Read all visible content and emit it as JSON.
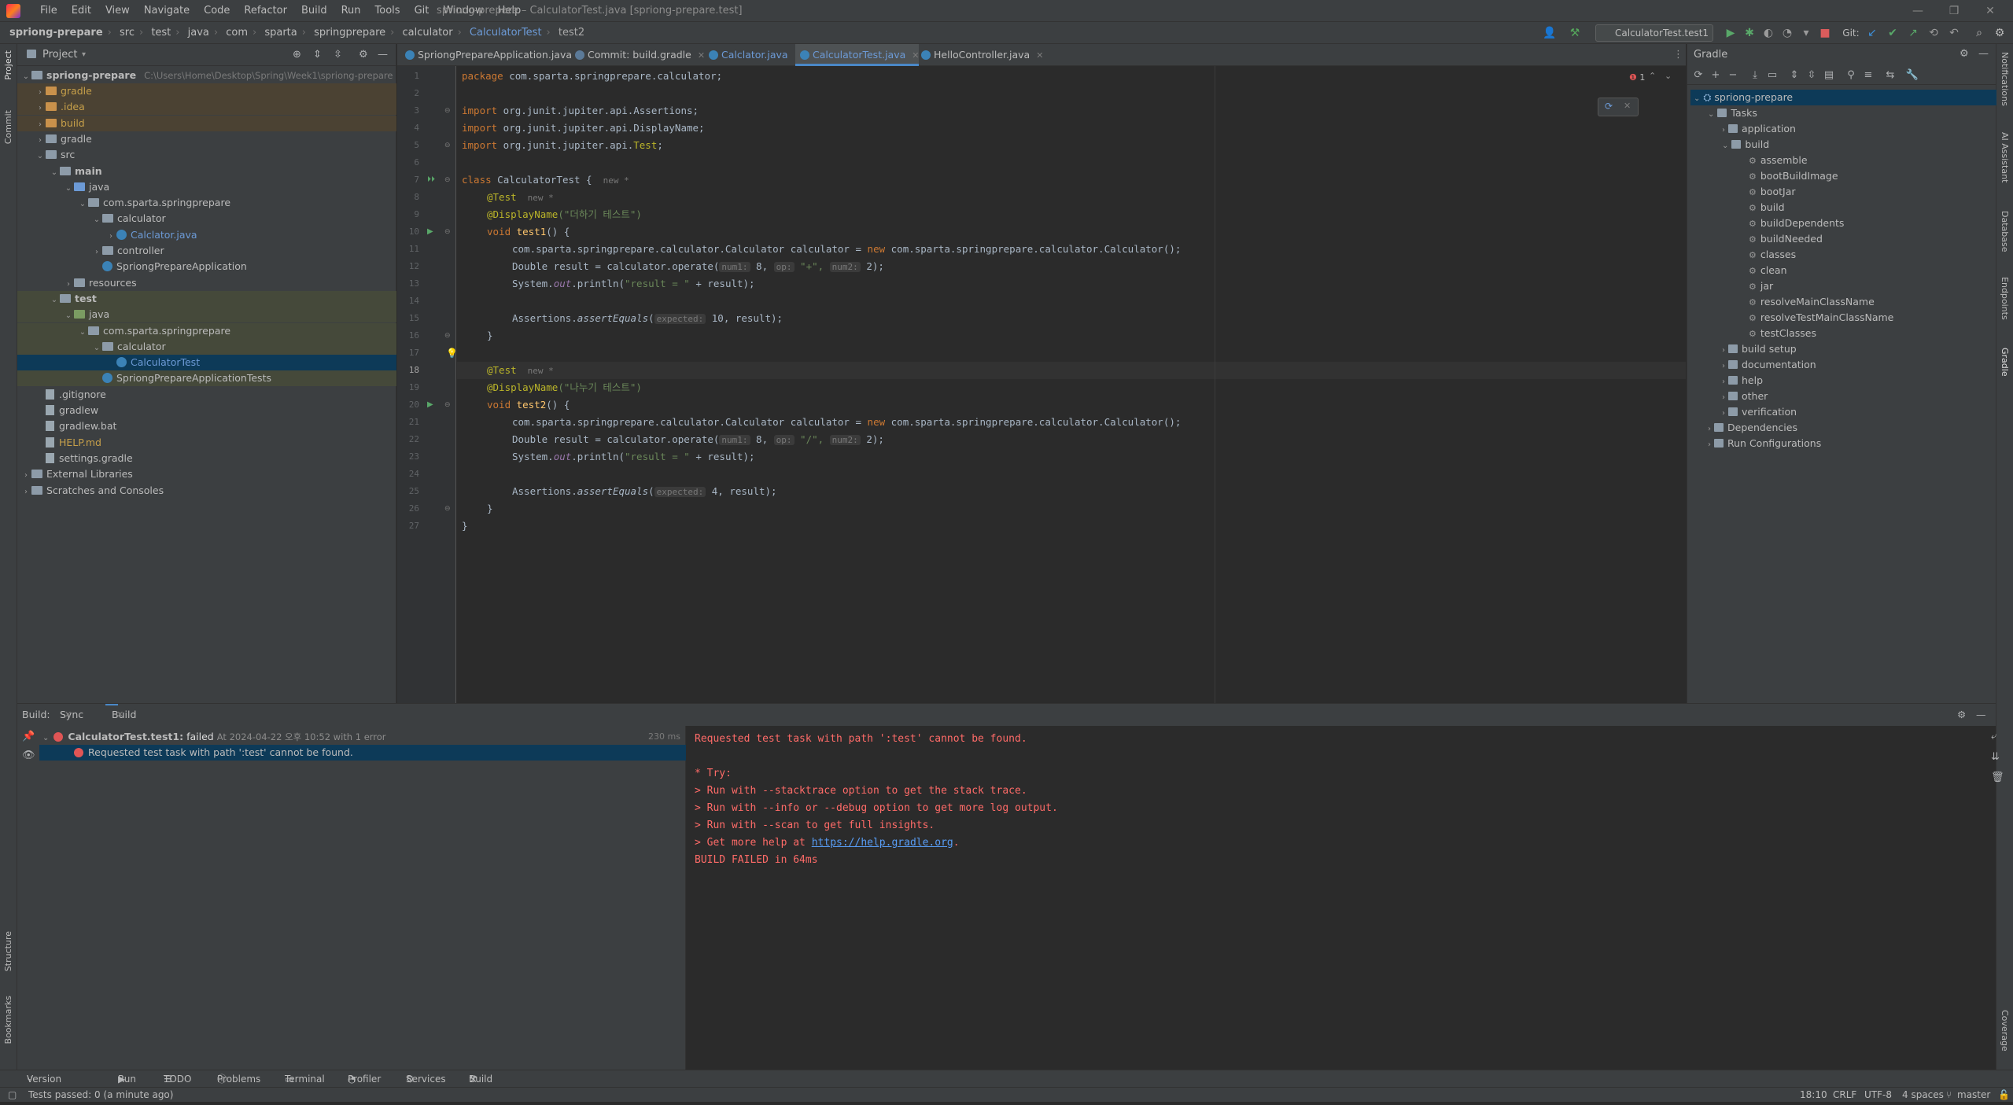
{
  "window": {
    "title": "spriong-prepare – CalculatorTest.java [spriong-prepare.test]",
    "menus": [
      "File",
      "Edit",
      "View",
      "Navigate",
      "Code",
      "Refactor",
      "Build",
      "Run",
      "Tools",
      "Git",
      "Window",
      "Help"
    ]
  },
  "breadcrumb": [
    "spriong-prepare",
    "src",
    "test",
    "java",
    "com",
    "sparta",
    "springprepare",
    "calculator",
    "CalculatorTest",
    "test2"
  ],
  "toolbar": {
    "run_config": "CalculatorTest.test1",
    "git_label": "Git:"
  },
  "project_panel": {
    "title": "Project",
    "root_label": "spriong-prepare",
    "root_path": "C:\\Users\\Home\\Desktop\\Spring\\Week1\\spriong-prepare",
    "items": [
      {
        "label": "gradle",
        "depth": 1,
        "type": "folder-orange",
        "arrow": "›"
      },
      {
        "label": ".idea",
        "depth": 1,
        "type": "folder-orange",
        "arrow": "›"
      },
      {
        "label": "build",
        "depth": 1,
        "type": "folder-orange",
        "arrow": "›"
      },
      {
        "label": "gradle",
        "depth": 1,
        "type": "folder",
        "arrow": "›"
      },
      {
        "label": "src",
        "depth": 1,
        "type": "folder",
        "arrow": "⌄"
      },
      {
        "label": "main",
        "depth": 2,
        "type": "folder",
        "arrow": "⌄"
      },
      {
        "label": "java",
        "depth": 3,
        "type": "folder-blue",
        "arrow": "⌄"
      },
      {
        "label": "com.sparta.springprepare",
        "depth": 4,
        "type": "folder",
        "arrow": "⌄"
      },
      {
        "label": "calculator",
        "depth": 5,
        "type": "folder",
        "arrow": "⌄"
      },
      {
        "label": "Calclator.java",
        "depth": 6,
        "type": "class",
        "arrow": "›"
      },
      {
        "label": "controller",
        "depth": 5,
        "type": "folder",
        "arrow": "›"
      },
      {
        "label": "SpriongPrepareApplication",
        "depth": 5,
        "type": "class",
        "arrow": ""
      },
      {
        "label": "resources",
        "depth": 3,
        "type": "folder",
        "arrow": "›"
      },
      {
        "label": "test",
        "depth": 2,
        "type": "folder",
        "arrow": "⌄"
      },
      {
        "label": "java",
        "depth": 3,
        "type": "folder-green",
        "arrow": "⌄"
      },
      {
        "label": "com.sparta.springprepare",
        "depth": 4,
        "type": "folder",
        "arrow": "⌄"
      },
      {
        "label": "calculator",
        "depth": 5,
        "type": "folder",
        "arrow": "⌄"
      },
      {
        "label": "CalculatorTest",
        "depth": 6,
        "type": "class",
        "arrow": ""
      },
      {
        "label": "SpriongPrepareApplicationTests",
        "depth": 5,
        "type": "class",
        "arrow": ""
      },
      {
        "label": ".gitignore",
        "depth": 1,
        "type": "file",
        "arrow": ""
      },
      {
        "label": "gradlew",
        "depth": 1,
        "type": "file",
        "arrow": ""
      },
      {
        "label": "gradlew.bat",
        "depth": 1,
        "type": "file",
        "arrow": ""
      },
      {
        "label": "HELP.md",
        "depth": 1,
        "type": "file",
        "arrow": ""
      },
      {
        "label": "settings.gradle",
        "depth": 1,
        "type": "file",
        "arrow": ""
      },
      {
        "label": "External Libraries",
        "depth": 0,
        "type": "folder",
        "arrow": "›"
      },
      {
        "label": "Scratches and Consoles",
        "depth": 0,
        "type": "folder",
        "arrow": "›"
      }
    ]
  },
  "editor_tabs": [
    {
      "label": "SpriongPrepareApplication.java"
    },
    {
      "label": "Commit: build.gradle"
    },
    {
      "label": "Calclator.java"
    },
    {
      "label": "CalculatorTest.java"
    },
    {
      "label": "HelloController.java"
    }
  ],
  "editor": {
    "error_count": "1",
    "new_badge": "new *",
    "lines": [
      "1",
      "2",
      "3",
      "4",
      "5",
      "6",
      "7",
      "8",
      "9",
      "10",
      "11",
      "12",
      "13",
      "14",
      "15",
      "16",
      "17",
      "18",
      "19",
      "20",
      "21",
      "22",
      "23",
      "24",
      "25",
      "26",
      "27"
    ],
    "code": {
      "package": "package",
      "package_name": " com.sparta.springprepare.calculator;",
      "import": "import",
      "imp1": " org.junit.jupiter.api.Assertions;",
      "imp2": " org.junit.jupiter.api.DisplayName;",
      "imp3a": " org.junit.jupiter.api.",
      "imp3b": "Test",
      "imp3c": ";",
      "class": "class",
      "class_name": " CalculatorTest {",
      "test_ann": "@Test",
      "display_ann": "@DisplayName",
      "disp1": "(\"더하기 테스트\")",
      "disp2": "(\"나누기 테스트\")",
      "void": "void",
      "test1": " test1",
      "test2": " test2",
      "sig_end": "() {",
      "calc_decl": "com.sparta.springprepare.calculator.Calculator calculator = ",
      "new": "new",
      "calc_new": " com.sparta.springprepare.calculator.Calculator();",
      "double_res": "Double result = calculator.operate(",
      "hint_num1": "num1:",
      "hint_op": "op:",
      "hint_num2": "num2:",
      "num8": " 8, ",
      "op_plus": " \"+\", ",
      "op_div": " \"/\", ",
      "num2": " 2);",
      "sysout_a": "System.",
      "sysout_out": "out",
      "sysout_b": ".println(",
      "sysout_str": "\"result = \"",
      "sysout_c": " + result);",
      "assert_a": "Assertions.",
      "assert_m": "assertEquals",
      "assert_open": "(",
      "hint_expected": "expected:",
      "exp10": " 10, result);",
      "exp4": " 4, result);",
      "close": "}"
    }
  },
  "gradle_panel": {
    "title": "Gradle",
    "root": "spriong-prepare",
    "tasks": "Tasks",
    "application": "application",
    "build": "build",
    "build_tasks": [
      "assemble",
      "bootBuildImage",
      "bootJar",
      "build",
      "buildDependents",
      "buildNeeded",
      "classes",
      "clean",
      "jar",
      "resolveMainClassName",
      "resolveTestMainClassName",
      "testClasses"
    ],
    "groups": [
      "build setup",
      "documentation",
      "help",
      "other",
      "verification"
    ],
    "dependencies": "Dependencies",
    "run_configs": "Run Configurations"
  },
  "build_panel": {
    "label": "Build:",
    "tab_sync": "Sync",
    "tab_output": "Build Output",
    "task": "CalculatorTest.test1:",
    "status": "failed",
    "time": "At 2024-04-22 오후 10:52 with 1 error",
    "duration": "230 ms",
    "error": "Requested test task with path ':test' cannot be found.",
    "console": [
      "Requested test task with path ':test' cannot be found.",
      "",
      "* Try:",
      "> Run with --stacktrace option to get the stack trace.",
      "> Run with --info or --debug option to get more log output.",
      "> Run with --scan to get full insights.",
      "> Get more help at ",
      "BUILD FAILED in 64ms"
    ],
    "help_link": "https://help.gradle.org",
    "help_link_suffix": "."
  },
  "bottom_tabs": [
    "Version Control",
    "Run",
    "TODO",
    "Problems",
    "Terminal",
    "Profiler",
    "Services",
    "Build"
  ],
  "left_tools": [
    "Project",
    "Commit",
    "Structure",
    "Bookmarks"
  ],
  "right_tools": [
    "Notifications",
    "AI Assistant",
    "Database",
    "Endpoints",
    "Gradle",
    "Coverage"
  ],
  "status": {
    "message": "Tests passed: 0 (a minute ago)",
    "position": "18:10",
    "line_sep": "CRLF",
    "encoding": "UTF-8",
    "indent": "4 spaces",
    "branch": "master"
  },
  "colors": {
    "accent": "#4a88c7",
    "error": "#ff6b68",
    "keyword": "#cc7832",
    "string": "#6a8759",
    "annotation": "#bbb529"
  }
}
